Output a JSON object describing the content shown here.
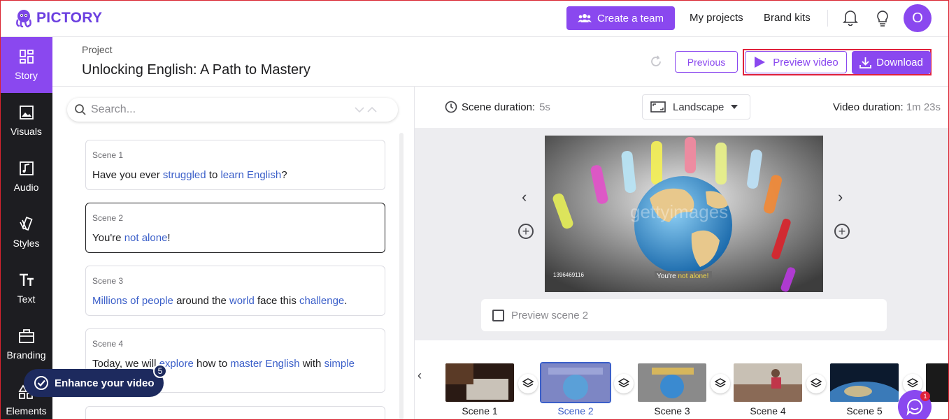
{
  "brand": {
    "name": "PICTORY",
    "accent": "#8a48ef",
    "highlight": "#3b5fc9",
    "sidebar_bg": "#1d1d21"
  },
  "topbar": {
    "create_team": "Create a team",
    "my_projects": "My projects",
    "brand_kits": "Brand kits",
    "avatar_letter": "O"
  },
  "sidebar": {
    "items": [
      {
        "label": "Story",
        "icon": "story-icon",
        "active": true
      },
      {
        "label": "Visuals",
        "icon": "image-icon"
      },
      {
        "label": "Audio",
        "icon": "music-icon"
      },
      {
        "label": "Styles",
        "icon": "styles-icon"
      },
      {
        "label": "Text",
        "icon": "text-icon"
      },
      {
        "label": "Branding",
        "icon": "briefcase-icon"
      },
      {
        "label": "Elements",
        "icon": "shapes-icon"
      }
    ]
  },
  "project": {
    "label": "Project",
    "title": "Unlocking English: A Path to Mastery",
    "previous": "Previous",
    "preview_video": "Preview video",
    "download": "Download"
  },
  "search": {
    "placeholder": "Search..."
  },
  "scenes": [
    {
      "name": "Scene 1",
      "parts": [
        [
          "Have you ever ",
          false
        ],
        [
          "struggled",
          true
        ],
        [
          " to ",
          false
        ],
        [
          "learn English",
          true
        ],
        [
          "?",
          false
        ]
      ]
    },
    {
      "name": "Scene 2",
      "parts": [
        [
          "You're ",
          false
        ],
        [
          "not alone",
          true
        ],
        [
          "!",
          false
        ]
      ]
    },
    {
      "name": "Scene 3",
      "parts": [
        [
          "Millions of people",
          true
        ],
        [
          " around the ",
          false
        ],
        [
          "world",
          true
        ],
        [
          " face this ",
          false
        ],
        [
          "challenge",
          true
        ],
        [
          ".",
          false
        ]
      ]
    },
    {
      "name": "Scene 4",
      "parts": [
        [
          "Today, we will ",
          false
        ],
        [
          "explore",
          true
        ],
        [
          " how to ",
          false
        ],
        [
          "master English",
          true
        ],
        [
          " with ",
          false
        ],
        [
          "simple",
          true
        ]
      ]
    }
  ],
  "enhance": {
    "label": "Enhance your video",
    "count": "5"
  },
  "preview": {
    "scene_duration_label": "Scene duration:",
    "scene_duration_value": "5s",
    "orientation": "Landscape",
    "video_duration_label": "Video duration:",
    "video_duration_value": "1m 23s",
    "image_id": "1396469116",
    "watermark": "gettyimages",
    "caption_plain": "You're ",
    "caption_highlight": "not alone!",
    "preview_scene": "Preview scene 2"
  },
  "filmstrip": [
    "Scene 1",
    "Scene 2",
    "Scene 3",
    "Scene 4",
    "Scene 5"
  ],
  "chat_badge": "1"
}
